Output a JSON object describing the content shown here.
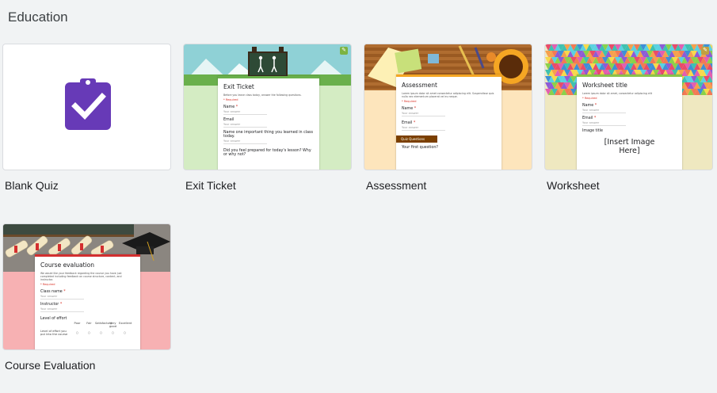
{
  "section": {
    "title": "Education"
  },
  "cards": [
    {
      "label": "Blank Quiz"
    },
    {
      "label": "Exit Ticket",
      "form": {
        "title": "Exit Ticket",
        "description": "Before you leave class today, answer the following questions.",
        "required": "* Required",
        "questions": [
          {
            "q": "Name",
            "star": "*",
            "a": "Your answer"
          },
          {
            "q": "Email",
            "star": "",
            "a": "Your answer"
          },
          {
            "q": "Name one important thing you learned in class today.",
            "star": "",
            "a": "Your answer"
          },
          {
            "q": "Did you feel prepared for today's lesson? Why or why not?",
            "star": "",
            "a": ""
          }
        ]
      }
    },
    {
      "label": "Assessment",
      "form": {
        "title": "Assessment",
        "description": "Lorem ipsum dolor sit amet consectetur adipiscing elit. Suspendisse quis nulla nec elementum placerat vel eu neque.",
        "required": "* Required",
        "questions": [
          {
            "q": "Name",
            "star": "*",
            "a": "Your answer"
          },
          {
            "q": "Email",
            "star": "*",
            "a": "Your answer"
          }
        ],
        "section_tag": "Quiz Questions",
        "first_q": "Your first question?"
      }
    },
    {
      "label": "Worksheet",
      "form": {
        "title": "Worksheet title",
        "description": "Lorem ipsum dolor sit amet, consectetur adipiscing elit",
        "required": "* Required",
        "questions": [
          {
            "q": "Name",
            "star": "*",
            "a": "Your answer"
          },
          {
            "q": "Email",
            "star": "*",
            "a": "Your answer"
          },
          {
            "q": "Image title",
            "star": "",
            "a": ""
          }
        ],
        "image_placeholder": "[Insert Image Here]"
      }
    },
    {
      "label": "Course Evaluation",
      "form": {
        "title": "Course evaluation",
        "description": "We would like your feedback regarding the course you have just completed including feedback on course structure, content, and instructor.",
        "required": "* Required",
        "questions": [
          {
            "q": "Class name",
            "star": "*",
            "a": "Your answer"
          },
          {
            "q": "Instructor",
            "star": "*",
            "a": "Your answer"
          }
        ],
        "grid_label": "Level of effort",
        "grid_cols": [
          "Poor",
          "Fair",
          "Satisfactory",
          "Very good",
          "Excellent"
        ],
        "grid_row": "Level of effort you put into the course"
      }
    }
  ],
  "colors": {
    "quiz_purple": "#673ab7",
    "exit_green": "#d4ecc3",
    "assessment_peach": "#fde5bc",
    "worksheet_cream": "#efe8c0",
    "course_pink": "#f7b1b3",
    "accent_green": "#7cb342"
  }
}
